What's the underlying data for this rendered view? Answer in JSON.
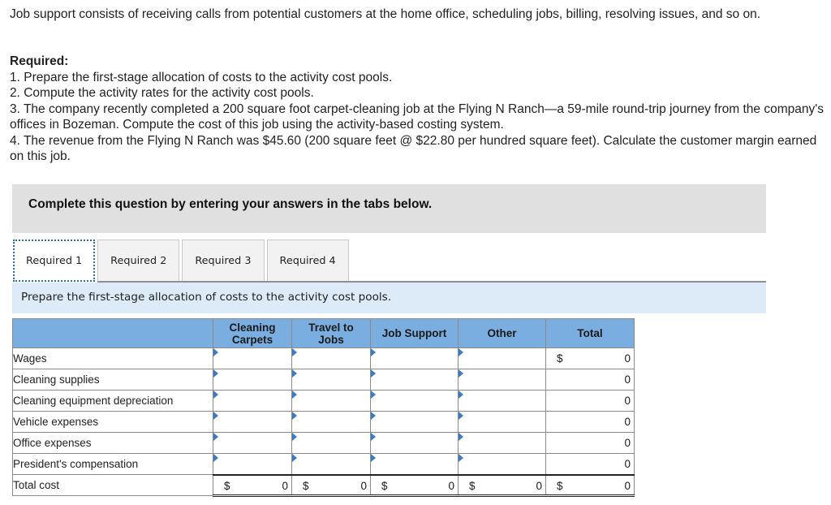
{
  "intro": {
    "text": "Job support consists of receiving calls from potential customers at the home office, scheduling jobs, billing, resolving issues, and so on."
  },
  "required": {
    "heading": "Required:",
    "items": [
      "1. Prepare the first-stage allocation of costs to the activity cost pools.",
      "2. Compute the activity rates for the activity cost pools.",
      "3. The company recently completed a 200 square foot carpet-cleaning job at the Flying N Ranch—a 59-mile round-trip journey from the company's offices in Bozeman. Compute the cost of this job using the activity-based costing system.",
      "4. The revenue from the Flying N Ranch was $45.60 (200 square feet @ $22.80 per hundred square feet). Calculate the customer margin earned on this job."
    ]
  },
  "instruction": "Complete this question by entering your answers in the tabs below.",
  "tabs": [
    {
      "label": "Required 1",
      "active": true
    },
    {
      "label": "Required 2",
      "active": false
    },
    {
      "label": "Required 3",
      "active": false
    },
    {
      "label": "Required 4",
      "active": false
    }
  ],
  "prompt": "Prepare the first-stage allocation of costs to the activity cost pools.",
  "table": {
    "headers": [
      "",
      "Cleaning Carpets",
      "Travel to Jobs",
      "Job Support",
      "Other",
      "Total"
    ],
    "header_lines": {
      "cleaning_carpets": [
        "Cleaning",
        "Carpets"
      ],
      "travel_to_jobs": [
        "Travel to",
        "Jobs"
      ]
    },
    "rows": [
      {
        "label": "Wages",
        "inputs": [
          "",
          "",
          "",
          ""
        ],
        "total_currency": "$",
        "total": "0"
      },
      {
        "label": "Cleaning supplies",
        "inputs": [
          "",
          "",
          "",
          ""
        ],
        "total_currency": "",
        "total": "0"
      },
      {
        "label": "Cleaning equipment depreciation",
        "inputs": [
          "",
          "",
          "",
          ""
        ],
        "total_currency": "",
        "total": "0"
      },
      {
        "label": "Vehicle expenses",
        "inputs": [
          "",
          "",
          "",
          ""
        ],
        "total_currency": "",
        "total": "0"
      },
      {
        "label": "Office expenses",
        "inputs": [
          "",
          "",
          "",
          ""
        ],
        "total_currency": "",
        "total": "0"
      },
      {
        "label": "President's compensation",
        "inputs": [
          "",
          "",
          "",
          ""
        ],
        "total_currency": "",
        "total": "0"
      }
    ],
    "total_row": {
      "label": "Total cost",
      "currency": "$",
      "values": [
        "0",
        "0",
        "0",
        "0",
        "0"
      ]
    }
  },
  "colors": {
    "header_blue": "#7aade0",
    "prompt_bg": "#dcebf7",
    "instruction_bg": "#e0e0e0",
    "input_border": "#4a74a8",
    "active_tab_focus": "#2a6bb5"
  }
}
